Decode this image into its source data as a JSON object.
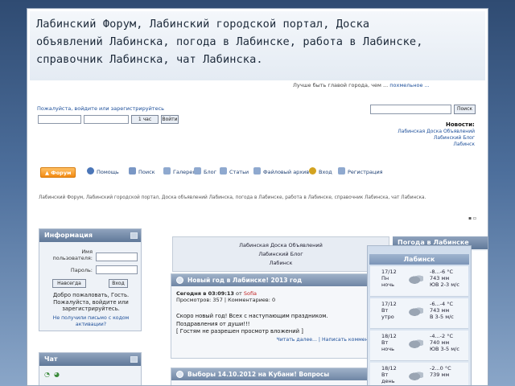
{
  "banner": {
    "title_lines": [
      "Лабинский Форум, Лабинский городской портал, Доска",
      "объявлений Лабинска, погода в Лабинске, работа в Лабинске,",
      "справочник Лабинска, чат Лабинска."
    ]
  },
  "header": {
    "greeting": "Лучше быть главой города, чем ...",
    "greeting_link": "похмельное ...",
    "login_hint": "Пожалуйста, войдите или зарегистрируйтесь",
    "login_button": "Войти",
    "period": "1 час",
    "search_button": "Поиск",
    "news_heading": "Новости:",
    "news_links": [
      "Лабинская Доска Объявлений",
      "Лабинский Блог",
      "Лабинск"
    ]
  },
  "menu": {
    "items": [
      {
        "label": "Форум",
        "icon": "home-icon",
        "color": "#f28a12"
      },
      {
        "label": "Помощь",
        "icon": "help-icon",
        "color": "#4b76b8"
      },
      {
        "label": "Поиск",
        "icon": "search-icon",
        "color": "#4b76b8"
      },
      {
        "label": "Галерея",
        "icon": "gallery-icon",
        "color": "#4b76b8"
      },
      {
        "label": "Блог",
        "icon": "blog-icon",
        "color": "#4b76b8"
      },
      {
        "label": "Статьи",
        "icon": "articles-icon",
        "color": "#4b76b8"
      },
      {
        "label": "Файловый архив",
        "icon": "archive-icon",
        "color": "#4b76b8"
      },
      {
        "label": "Вход",
        "icon": "key-icon",
        "color": "#d3a320"
      },
      {
        "label": "Регистрация",
        "icon": "register-icon",
        "color": "#4b76b8"
      }
    ]
  },
  "breadcrumb": {
    "text": "Лабинский Форум, Лабинский городской портал, Доска объявлений Лабинска, погода в Лабинске, работа в Лабинске, справочник Лабинска, чат Лабинска."
  },
  "info_block": {
    "title": "Информация",
    "username_label": "Имя пользователя:",
    "password_label": "Пароль:",
    "remember_label": "Навсегда",
    "login_button": "Вход",
    "welcome_text": "Добро пожаловать, Гость. Пожалуйста, войдите или зарегистрируйтесь.",
    "activation_text": "Не получили письмо с кодом активации?"
  },
  "chat_block": {
    "title": "Чат"
  },
  "center_links": [
    "Лабинская Доска Объявлений",
    "Лабинский Блог",
    "Лабинск"
  ],
  "topics": [
    {
      "title": "Новый год в Лабинске! 2013 год",
      "today_prefix": "Сегодня в 03:09:13",
      "author": "Sofia",
      "views": "Просмотров: 357",
      "comments": "Комментариев: 0",
      "body_lines": [
        "Скоро новый год! Всех с наступающим праздником.",
        "Поздравления от души!!!",
        "[ Гостям не разрешен просмотр вложений ]"
      ],
      "read_more": "Читать далее...",
      "write_comment": "Написать комментарий"
    },
    {
      "title": "Выборы 14.10.2012 на Кубани! Вопросы"
    }
  ],
  "weather": {
    "title": "Погода в Лабинске",
    "city": "Лабинск",
    "days": [
      {
        "date": "17/12",
        "weekday": "Пн",
        "time": "ночь",
        "temp": "-8...-6 °C",
        "pressure": "743 мм",
        "wind": "ЮВ 2-3 м/с"
      },
      {
        "date": "17/12",
        "weekday": "Вт",
        "time": "утро",
        "temp": "-6...-4 °C",
        "pressure": "743 мм",
        "wind": "В 3-5 м/с"
      },
      {
        "date": "18/12",
        "weekday": "Вт",
        "time": "ночь",
        "temp": "-4...-2 °C",
        "pressure": "740 мм",
        "wind": "ЮВ 3-5 м/с"
      },
      {
        "date": "18/12",
        "weekday": "Вт",
        "time": "день",
        "temp": "-2...0 °C",
        "pressure": "739 мм",
        "wind": ""
      }
    ]
  }
}
